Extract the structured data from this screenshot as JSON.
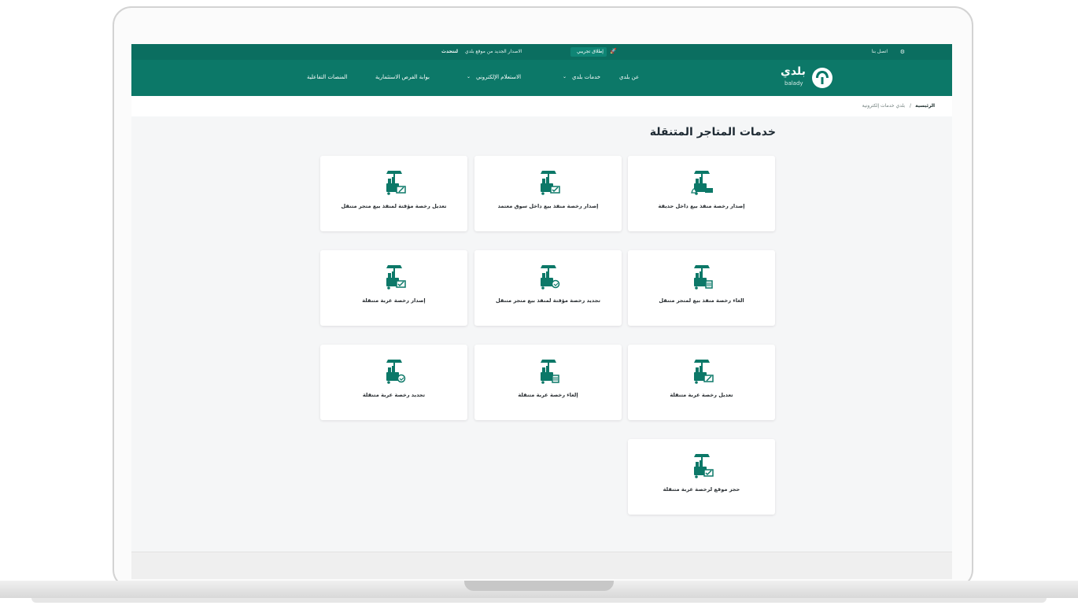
{
  "topbar": {
    "contact": "اتصل بنا",
    "new_badge": "إطلاق تجريبي",
    "notice": "الاصدار الجديد من موقع بلدي",
    "notice_action": "لنتحدث"
  },
  "nav": {
    "logo_ar": "بلدي",
    "logo_en": "balady",
    "items": [
      "عن بلدي",
      "خدمات بلدي",
      "الاستعلام الإلكتروني",
      "بوابة الفرص الاستثمارية",
      "المنصات التفاعلية"
    ]
  },
  "breadcrumb": {
    "home": "الرئيسية",
    "current": "بلدي خدمات إلكترونية"
  },
  "page": {
    "title": "خدمات المتاجر المتنقلة"
  },
  "services": [
    {
      "label": "إصدار رخصة منفذ بيع داخل حديقة",
      "icon": "cart-park-icon"
    },
    {
      "label": "إصدار رخصة منفذ بيع داخل سوق معتمد",
      "icon": "cart-check-icon"
    },
    {
      "label": "تعديل رخصة مؤقتة لمنفذ بيع متجر متنقل",
      "icon": "cart-edit-icon"
    },
    {
      "label": "الغاء رخصة منفذ بيع لمتجر متنقل",
      "icon": "cart-trash-icon"
    },
    {
      "label": "تجديد رخصة مؤقتة لمنفذ بيع متجر متنقل",
      "icon": "cart-renew-icon"
    },
    {
      "label": "إصدار رخصة عربة متنقلة",
      "icon": "cart-check-icon"
    },
    {
      "label": "تعديل رخصة عربة متنقلة",
      "icon": "cart-edit-icon"
    },
    {
      "label": "إلغاء رخصة عربة متنقلة",
      "icon": "cart-trash-icon"
    },
    {
      "label": "تجديد رخصة عربة متنقلة",
      "icon": "cart-renew-icon"
    },
    {
      "label": "حجز موقع لرخصة عربة متنقلة",
      "icon": "cart-check-icon"
    }
  ],
  "colors": {
    "brand": "#0c7868",
    "brand_dark": "#0b6e60",
    "page_bg": "#f5f6f7"
  }
}
